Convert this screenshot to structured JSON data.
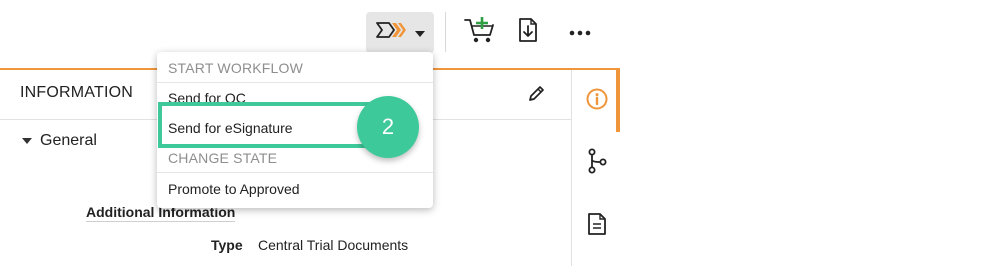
{
  "panel": {
    "title": "INFORMATION",
    "section_label": "General",
    "additional_info_label": "Additional Information",
    "type_label": "Type",
    "type_value": "Central Trial Documents"
  },
  "workflow_menu": {
    "start_header": "START WORKFLOW",
    "items_start": [
      "Send for QC",
      "Send for eSignature"
    ],
    "change_header": "CHANGE STATE",
    "items_change": [
      "Promote to Approved"
    ]
  },
  "callout": {
    "step_number": "2"
  },
  "icons": {
    "workflow": "workflow-chevrons-icon",
    "cart": "add-to-cart-icon",
    "download": "download-document-icon",
    "more": "more-options-icon",
    "edit": "pencil-icon",
    "info": "info-icon",
    "relationships": "branch-icon",
    "document": "document-icon"
  },
  "colors": {
    "accent": "#f0953a",
    "callout": "#3ec99a",
    "cart_plus": "#2ea043"
  }
}
